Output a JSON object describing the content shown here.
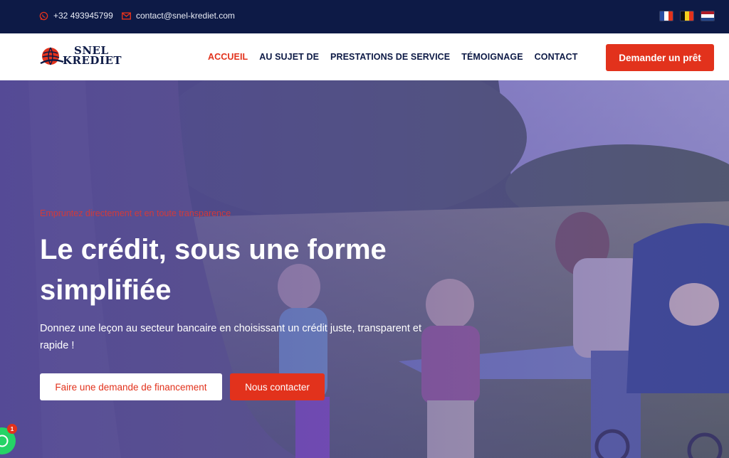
{
  "topbar": {
    "phone": "+32 493945799",
    "email": "contact@snel-krediet.com",
    "flags": [
      "flag-fr",
      "flag-be",
      "flag-nl"
    ]
  },
  "brand": {
    "line1": "SNEL",
    "line2": "KREDIET"
  },
  "nav": {
    "items": [
      {
        "label": "ACCUEIL",
        "active": true
      },
      {
        "label": "AU SUJET DE",
        "active": false
      },
      {
        "label": "PRESTATIONS DE SERVICE",
        "active": false
      },
      {
        "label": "TÉMOIGNAGE",
        "active": false
      },
      {
        "label": "CONTACT",
        "active": false
      }
    ],
    "cta_label": "Demander un prêt"
  },
  "hero": {
    "tagline": "Empruntez directement et en toute transparence",
    "headline": "Le crédit, sous une forme simplifiée",
    "subtext": "Donnez une leçon au secteur bancaire en choisissant un crédit juste, transparent et rapide !",
    "primary_button": "Faire une demande de financement",
    "secondary_button": "Nous contacter"
  },
  "whatsapp": {
    "badge_count": "1"
  },
  "colors": {
    "navy": "#0d1a46",
    "accent_red": "#e2321c",
    "overlay_purple": "#5346aa"
  }
}
